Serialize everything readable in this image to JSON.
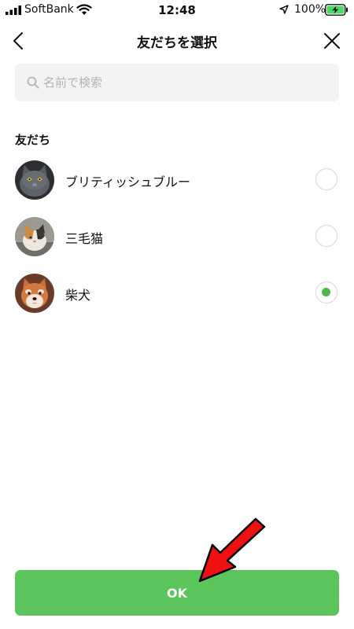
{
  "status_bar": {
    "carrier": "SoftBank",
    "time": "12:48",
    "battery_percent": "100%",
    "icons": [
      "signal-icon",
      "wifi-icon",
      "location-icon",
      "battery-charging-icon"
    ]
  },
  "header": {
    "title": "友だちを選択",
    "back_icon": "chevron-left-icon",
    "close_icon": "close-icon"
  },
  "search": {
    "placeholder": "名前で検索",
    "value": "",
    "icon": "search-icon"
  },
  "section_title": "友だち",
  "friends": [
    {
      "name": "ブリティッシュブルー",
      "selected": false
    },
    {
      "name": "三毛猫",
      "selected": false
    },
    {
      "name": "柴犬",
      "selected": true
    }
  ],
  "ok_button": {
    "label": "OK"
  },
  "colors": {
    "accent_green": "#5bc45b",
    "radio_selected": "#4cb84c",
    "search_bg": "#f3f3f3",
    "annotation_arrow": "#ee1111"
  }
}
